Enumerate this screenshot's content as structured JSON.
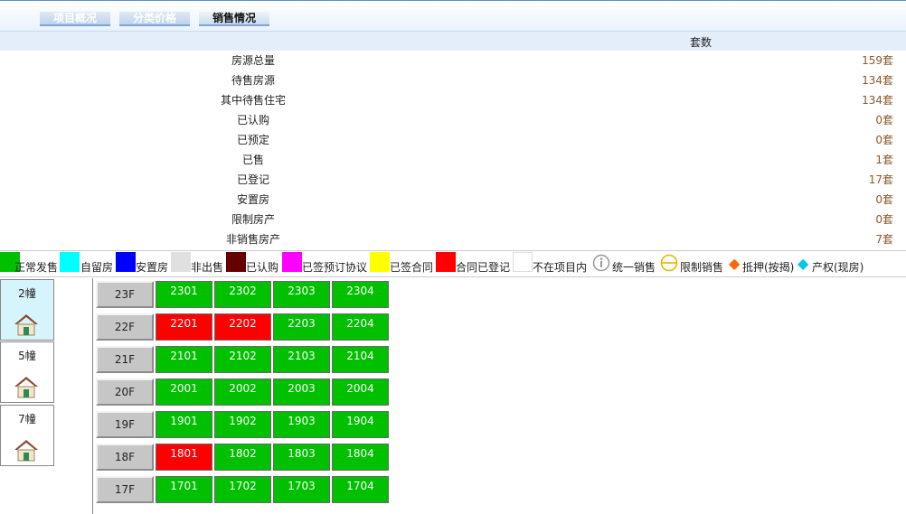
{
  "tabs": [
    {
      "label": "项目概况",
      "active": false
    },
    {
      "label": "分类价格",
      "active": false
    },
    {
      "label": "销售情况",
      "active": true
    }
  ],
  "table_header": {
    "count_col": "套数"
  },
  "stats": [
    {
      "label": "房源总量",
      "value": "159套"
    },
    {
      "label": "待售房源",
      "value": "134套"
    },
    {
      "label": "其中待售住宅",
      "value": "134套"
    },
    {
      "label": "已认购",
      "value": "0套"
    },
    {
      "label": "已预定",
      "value": "0套"
    },
    {
      "label": "已售",
      "value": "1套"
    },
    {
      "label": "已登记",
      "value": "17套"
    },
    {
      "label": "安置房",
      "value": "0套"
    },
    {
      "label": "限制房产",
      "value": "0套"
    },
    {
      "label": "非销售房产",
      "value": "7套"
    }
  ],
  "legend": [
    {
      "label": "正常发售",
      "color": "#00c000"
    },
    {
      "label": "自留房",
      "color": "#00ffff"
    },
    {
      "label": "安置房",
      "color": "#0000ff"
    },
    {
      "label": "非出售",
      "color": "#e0e0e0"
    },
    {
      "label": "已认购",
      "color": "#660000"
    },
    {
      "label": "已签预订协议",
      "color": "#ff00ff"
    },
    {
      "label": "已签合同",
      "color": "#ffff00"
    },
    {
      "label": "合同已登记",
      "color": "#ff0000"
    },
    {
      "label": "不在项目内",
      "color": "#ffffff"
    }
  ],
  "legend_symbols": [
    {
      "label": "统一销售",
      "icon": "info-circle-icon",
      "color": "#999999"
    },
    {
      "label": "限制销售",
      "icon": "restricted-circle-icon",
      "color": "#e8b400"
    },
    {
      "label": "抵押(按揭)",
      "icon": "diamond-icon",
      "color": "#ff6600"
    },
    {
      "label": "产权(现房)",
      "icon": "diamond-icon",
      "color": "#00c8e8"
    }
  ],
  "buildings": [
    {
      "name": "2幢",
      "active": true
    },
    {
      "name": "5幢",
      "active": false
    },
    {
      "name": "7幢",
      "active": false
    }
  ],
  "floors": [
    {
      "label": "23F",
      "units": [
        {
          "no": "2301",
          "status": "normal"
        },
        {
          "no": "2302",
          "status": "normal"
        },
        {
          "no": "2303",
          "status": "normal"
        },
        {
          "no": "2304",
          "status": "normal"
        }
      ]
    },
    {
      "label": "22F",
      "units": [
        {
          "no": "2201",
          "status": "registered"
        },
        {
          "no": "2202",
          "status": "registered"
        },
        {
          "no": "2203",
          "status": "normal"
        },
        {
          "no": "2204",
          "status": "normal"
        }
      ]
    },
    {
      "label": "21F",
      "units": [
        {
          "no": "2101",
          "status": "normal"
        },
        {
          "no": "2102",
          "status": "normal"
        },
        {
          "no": "2103",
          "status": "normal"
        },
        {
          "no": "2104",
          "status": "normal"
        }
      ]
    },
    {
      "label": "20F",
      "units": [
        {
          "no": "2001",
          "status": "normal"
        },
        {
          "no": "2002",
          "status": "normal"
        },
        {
          "no": "2003",
          "status": "normal"
        },
        {
          "no": "2004",
          "status": "normal"
        }
      ]
    },
    {
      "label": "19F",
      "units": [
        {
          "no": "1901",
          "status": "normal"
        },
        {
          "no": "1902",
          "status": "normal"
        },
        {
          "no": "1903",
          "status": "normal"
        },
        {
          "no": "1904",
          "status": "normal"
        }
      ]
    },
    {
      "label": "18F",
      "units": [
        {
          "no": "1801",
          "status": "registered"
        },
        {
          "no": "1802",
          "status": "normal"
        },
        {
          "no": "1803",
          "status": "normal"
        },
        {
          "no": "1804",
          "status": "normal"
        }
      ]
    },
    {
      "label": "17F",
      "units": [
        {
          "no": "1701",
          "status": "normal"
        },
        {
          "no": "1702",
          "status": "normal"
        },
        {
          "no": "1703",
          "status": "normal"
        },
        {
          "no": "1704",
          "status": "normal"
        }
      ]
    }
  ],
  "status_colors": {
    "normal": "#00c000",
    "registered": "#ff0000"
  }
}
